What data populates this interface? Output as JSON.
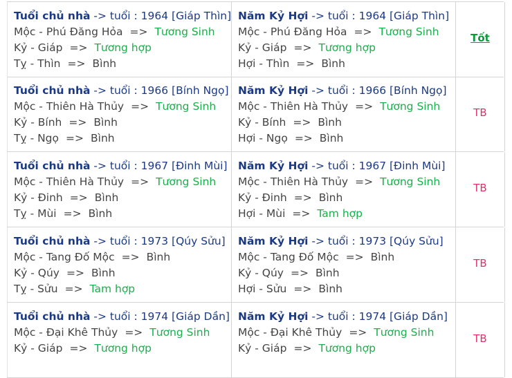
{
  "rows": [
    {
      "owner": {
        "title": "Tuổi chủ nhà",
        "arrow": " -> tuổi : 1964 [Giáp Thìn]",
        "lines": [
          {
            "a": "Mộc - Phú Đăng Hỏa",
            "sep": "=>",
            "b": "Tương Sinh",
            "hl": true
          },
          {
            "a": "Kỷ - Giáp",
            "sep": "=>",
            "b": "Tương hợp",
            "hl": true
          },
          {
            "a": "Tỵ - Thìn",
            "sep": "=>",
            "b": "Bình",
            "hl": false
          }
        ]
      },
      "year": {
        "title": "Năm Kỷ Hợi",
        "arrow": " -> tuổi : 1964 [Giáp Thìn]",
        "lines": [
          {
            "a": "Mộc - Phú Đăng Hỏa",
            "sep": "=>",
            "b": "Tương Sinh",
            "hl": true
          },
          {
            "a": "Kỷ - Giáp",
            "sep": "=>",
            "b": "Tương hợp",
            "hl": true
          },
          {
            "a": "Hợi - Thìn",
            "sep": "=>",
            "b": "Bình",
            "hl": false
          }
        ]
      },
      "verdict": "Tốt",
      "verdict_kind": "good"
    },
    {
      "owner": {
        "title": "Tuổi chủ nhà",
        "arrow": " -> tuổi : 1966 [Bính Ngọ]",
        "lines": [
          {
            "a": "Mộc - Thiên Hà Thủy",
            "sep": "=>",
            "b": "Tương Sinh",
            "hl": true
          },
          {
            "a": "Kỷ - Bính",
            "sep": "=>",
            "b": "Bình",
            "hl": false
          },
          {
            "a": "Tỵ - Ngọ",
            "sep": "=>",
            "b": "Bình",
            "hl": false
          }
        ]
      },
      "year": {
        "title": "Năm Kỷ Hợi",
        "arrow": " -> tuổi : 1966 [Bính Ngọ]",
        "lines": [
          {
            "a": "Mộc - Thiên Hà Thủy",
            "sep": "=>",
            "b": "Tương Sinh",
            "hl": true
          },
          {
            "a": "Kỷ - Bính",
            "sep": "=>",
            "b": "Bình",
            "hl": false
          },
          {
            "a": "Hợi - Ngọ",
            "sep": "=>",
            "b": "Bình",
            "hl": false
          }
        ]
      },
      "verdict": "TB",
      "verdict_kind": "tb"
    },
    {
      "owner": {
        "title": "Tuổi chủ nhà",
        "arrow": " -> tuổi : 1967 [Đinh Mùi]",
        "lines": [
          {
            "a": "Mộc - Thiên Hà Thủy",
            "sep": "=>",
            "b": "Tương Sinh",
            "hl": true
          },
          {
            "a": "Kỷ - Đinh",
            "sep": "=>",
            "b": "Bình",
            "hl": false
          },
          {
            "a": "Tỵ - Mùi",
            "sep": "=>",
            "b": "Bình",
            "hl": false
          }
        ]
      },
      "year": {
        "title": "Năm Kỷ Hợi",
        "arrow": " -> tuổi : 1967 [Đinh Mùi]",
        "lines": [
          {
            "a": "Mộc - Thiên Hà Thủy",
            "sep": "=>",
            "b": "Tương Sinh",
            "hl": true
          },
          {
            "a": "Kỷ - Đinh",
            "sep": "=>",
            "b": "Bình",
            "hl": false
          },
          {
            "a": "Hợi - Mùi",
            "sep": "=>",
            "b": "Tam hợp",
            "hl": true
          }
        ]
      },
      "verdict": "TB",
      "verdict_kind": "tb"
    },
    {
      "owner": {
        "title": "Tuổi chủ nhà",
        "arrow": " -> tuổi : 1973 [Qúy Sửu]",
        "lines": [
          {
            "a": "Mộc - Tang Đố Mộc",
            "sep": "=>",
            "b": "Bình",
            "hl": false
          },
          {
            "a": "Kỷ - Qúy",
            "sep": "=>",
            "b": "Bình",
            "hl": false
          },
          {
            "a": "Tỵ - Sửu",
            "sep": "=>",
            "b": "Tam hợp",
            "hl": true
          }
        ]
      },
      "year": {
        "title": "Năm Kỷ Hợi",
        "arrow": " -> tuổi : 1973 [Qúy Sửu]",
        "lines": [
          {
            "a": "Mộc - Tang Đố Mộc",
            "sep": "=>",
            "b": "Bình",
            "hl": false
          },
          {
            "a": "Kỷ - Qúy",
            "sep": "=>",
            "b": "Bình",
            "hl": false
          },
          {
            "a": "Hợi - Sửu",
            "sep": "=>",
            "b": "Bình",
            "hl": false
          }
        ]
      },
      "verdict": "TB",
      "verdict_kind": "tb"
    },
    {
      "owner": {
        "title": "Tuổi chủ nhà",
        "arrow": " -> tuổi : 1974 [Giáp Dần]",
        "lines": [
          {
            "a": "Mộc - Đại Khê Thủy",
            "sep": "=>",
            "b": "Tương Sinh",
            "hl": true
          },
          {
            "a": "Kỷ - Giáp",
            "sep": "=>",
            "b": "Tương hợp",
            "hl": true
          }
        ]
      },
      "year": {
        "title": "Năm Kỷ Hợi",
        "arrow": " -> tuổi : 1974 [Giáp Dần]",
        "lines": [
          {
            "a": "Mộc - Đại Khê Thủy",
            "sep": "=>",
            "b": "Tương Sinh",
            "hl": true
          },
          {
            "a": "Kỷ - Giáp",
            "sep": "=>",
            "b": "Tương hợp",
            "hl": true
          }
        ]
      },
      "verdict": "TB",
      "verdict_kind": "tb"
    }
  ]
}
